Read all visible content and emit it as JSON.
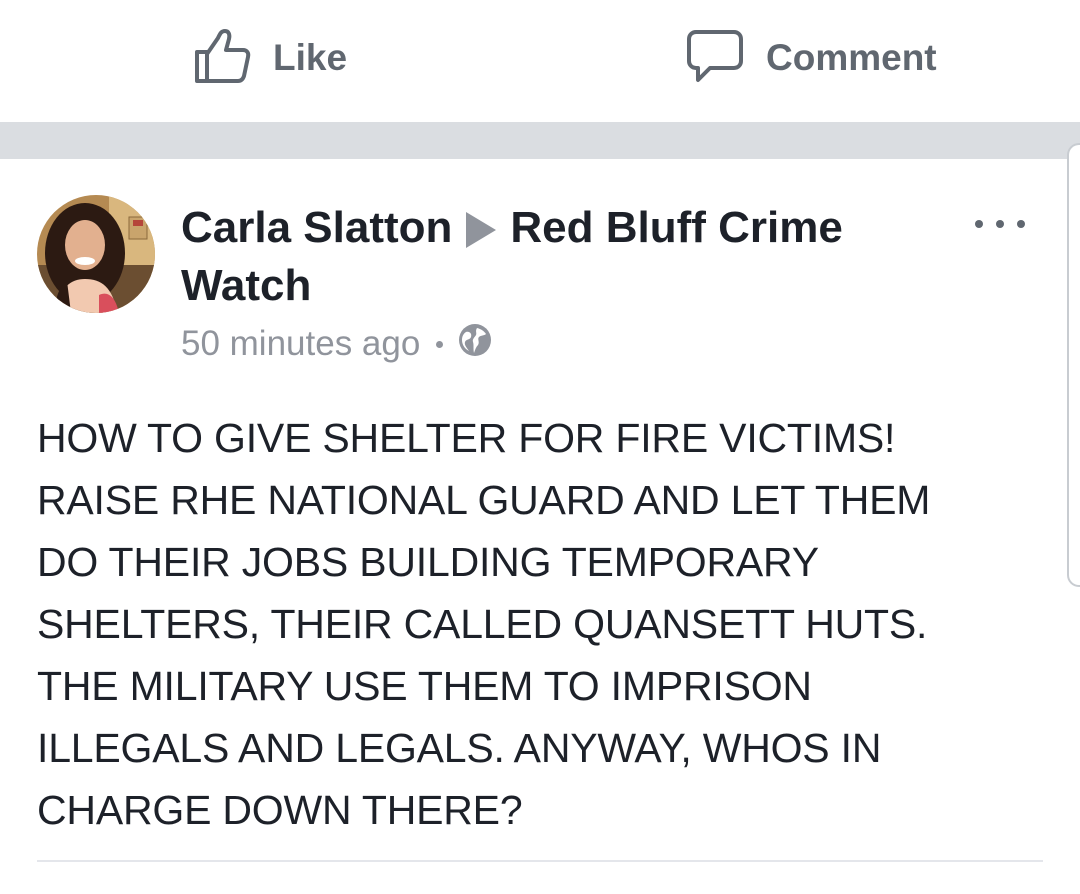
{
  "actions": {
    "like_label": "Like",
    "like_icon": "thumbs-up-icon",
    "comment_label": "Comment",
    "comment_icon": "speech-bubble-icon"
  },
  "post": {
    "author": "Carla Slatton",
    "target_group": "Red Bluff Crime Watch",
    "timestamp": "50 minutes ago",
    "privacy_icon": "globe-icon",
    "more_icon": "more-options-icon",
    "text": "HOW TO GIVE SHELTER FOR FIRE VICTIMS!\nRAISE RHE NATIONAL GUARD AND LET THEM\nDO THEIR JOBS BUILDING TEMPORARY\nSHELTERS, THEIR CALLED QUANSETT HUTS.\nTHE MILITARY USE THEM TO IMPRISON\nILLEGALS AND LEGALS. ANYWAY, WHOS IN\nCHARGE DOWN THERE?"
  },
  "colors": {
    "separator": "#dadde1",
    "secondary_text": "#90949c",
    "action_text": "#606770",
    "primary_text": "#1d2129"
  }
}
